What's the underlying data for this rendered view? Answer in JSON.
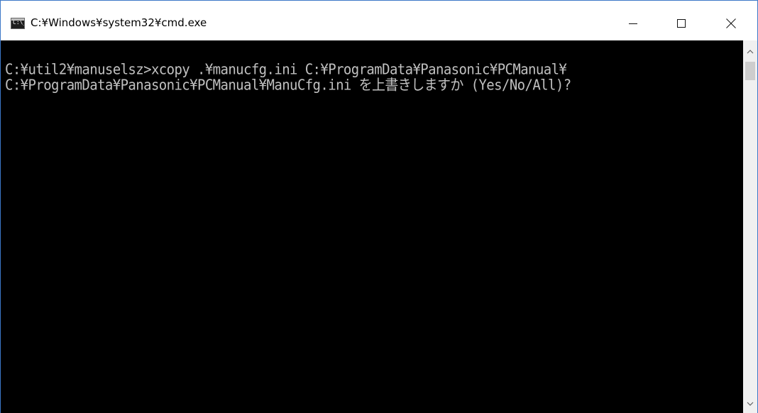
{
  "window": {
    "title": "C:¥Windows¥system32¥cmd.exe",
    "icon": "cmd-icon",
    "icon_label": "C:\\_"
  },
  "controls": {
    "minimize": "minimize-icon",
    "maximize": "maximize-icon",
    "close": "close-icon"
  },
  "console": {
    "lines": [
      "C:¥util2¥manuselsz>xcopy .¥manucfg.ini C:¥ProgramData¥Panasonic¥PCManual¥",
      "C:¥ProgramData¥Panasonic¥PCManual¥ManuCfg.ini を上書きしますか (Yes/No/All)?"
    ]
  },
  "scrollbar": {
    "up": "scroll-up-icon",
    "down": "scroll-down-icon"
  },
  "colors": {
    "console_bg": "#000000",
    "console_text": "#c0c0c0",
    "titlebar_bg": "#ffffff",
    "border": "#3c78c8"
  }
}
